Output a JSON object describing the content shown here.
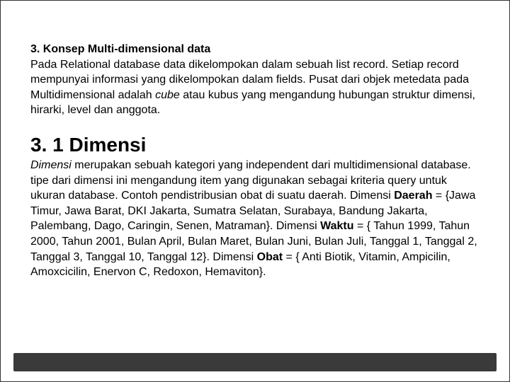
{
  "section3": {
    "heading": "3. Konsep Multi-dimensional data",
    "para_before_cube": "Pada Relational database data dikelompokan dalam sebuah list record. Setiap record mempunyai informasi yang dikelompokan dalam fields. Pusat dari objek metedata pada Multidimensional adalah ",
    "cube_word": "cube",
    "para_after_cube": " atau kubus yang mengandung hubungan struktur dimensi, hirarki, level dan anggota."
  },
  "section31": {
    "heading": "3. 1 Dimensi",
    "lead_word": "Dimensi",
    "p1": " merupakan sebuah kategori yang independent dari multidimensional database. tipe dari dimensi ini mengandung item yang digunakan sebagai kriteria query untuk ukuran database. Contoh pendistribusian obat di suatu daerah. Dimensi ",
    "daerah_label": "Daerah",
    "daerah_vals": " = {Jawa Timur, Jawa Barat, DKI Jakarta, Sumatra Selatan, Surabaya, Bandung Jakarta, Palembang, Dago, Caringin, Senen, Matraman}. Dimensi ",
    "waktu_label": "Waktu",
    "waktu_vals": " = { Tahun 1999, Tahun 2000, Tahun 2001, Bulan April, Bulan Maret, Bulan Juni, Bulan Juli, Tanggal 1, Tanggal 2, Tanggal 3, Tanggal 10, Tanggal 12}. Dimensi ",
    "obat_label": "Obat",
    "obat_vals": " = { Anti Biotik, Vitamin, Ampicilin, Amoxcicilin, Enervon C, Redoxon, Hemaviton}."
  }
}
